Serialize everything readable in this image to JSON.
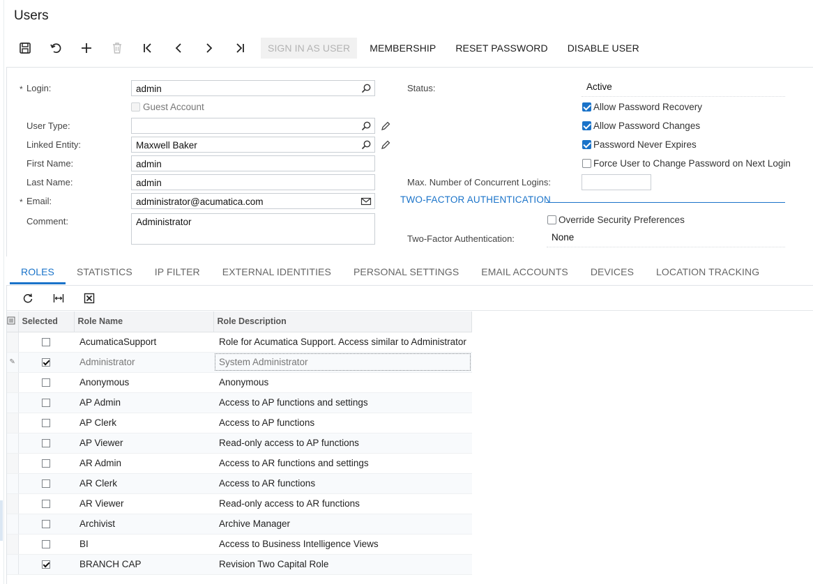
{
  "page": {
    "title": "Users"
  },
  "toolbar": {
    "icons": [
      "save-icon",
      "undo-icon",
      "add-icon",
      "delete-icon",
      "first-record-icon",
      "previous-record-icon",
      "next-record-icon",
      "last-record-icon"
    ],
    "sign_in_as_user": "SIGN IN AS USER",
    "membership": "MEMBERSHIP",
    "reset_password": "RESET PASSWORD",
    "disable_user": "DISABLE USER"
  },
  "form": {
    "login": {
      "label": "Login:",
      "value": "admin",
      "required": "*"
    },
    "guest_account": {
      "label": "Guest Account",
      "checked": false,
      "enabled": false
    },
    "user_type": {
      "label": "User Type:",
      "value": ""
    },
    "linked_entity": {
      "label": "Linked Entity:",
      "value": "Maxwell Baker"
    },
    "first_name": {
      "label": "First Name:",
      "value": "admin"
    },
    "last_name": {
      "label": "Last Name:",
      "value": "admin"
    },
    "email": {
      "label": "Email:",
      "value": "administrator@acumatica.com",
      "required": "*"
    },
    "comment": {
      "label": "Comment:",
      "value": "Administrator"
    },
    "status": {
      "label": "Status:",
      "value": "Active"
    },
    "allow_password_recovery": {
      "label": "Allow Password Recovery",
      "checked": true
    },
    "allow_password_changes": {
      "label": "Allow Password Changes",
      "checked": true
    },
    "password_never_expires": {
      "label": "Password Never Expires",
      "checked": true
    },
    "force_change_password": {
      "label": "Force User to Change Password on Next Login",
      "checked": false
    },
    "max_concurrent_logins": {
      "label": "Max. Number of Concurrent Logins:",
      "value": ""
    },
    "two_factor_section": "TWO-FACTOR AUTHENTICATION",
    "override_security": {
      "label": "Override Security Preferences",
      "checked": false
    },
    "two_factor_auth": {
      "label": "Two-Factor Authentication:",
      "value": "None"
    }
  },
  "tabs": [
    "ROLES",
    "STATISTICS",
    "IP FILTER",
    "EXTERNAL IDENTITIES",
    "PERSONAL SETTINGS",
    "EMAIL ACCOUNTS",
    "DEVICES",
    "LOCATION TRACKING"
  ],
  "active_tab": "ROLES",
  "grid": {
    "toolbar_icons": [
      "refresh-icon",
      "fit-columns-icon",
      "export-excel-icon"
    ],
    "columns": [
      "Selected",
      "Role Name",
      "Role Description"
    ],
    "rows": [
      {
        "selected": false,
        "role": "AcumaticaSupport",
        "description": "Role for Acumatica Support. Access similar to Administrator"
      },
      {
        "selected": true,
        "role": "Administrator",
        "description": "System Administrator",
        "editing": true
      },
      {
        "selected": false,
        "role": "Anonymous",
        "description": "Anonymous"
      },
      {
        "selected": false,
        "role": "AP Admin",
        "description": "Access to AP functions and settings"
      },
      {
        "selected": false,
        "role": "AP Clerk",
        "description": "Access to AP functions"
      },
      {
        "selected": false,
        "role": "AP Viewer",
        "description": "Read-only access to AP functions"
      },
      {
        "selected": false,
        "role": "AR Admin",
        "description": "Access to AR functions and settings"
      },
      {
        "selected": false,
        "role": "AR Clerk",
        "description": "Access to AR functions"
      },
      {
        "selected": false,
        "role": "AR Viewer",
        "description": "Read-only access to AR functions"
      },
      {
        "selected": false,
        "role": "Archivist",
        "description": "Archive Manager"
      },
      {
        "selected": false,
        "role": "BI",
        "description": "Access to Business Intelligence Views"
      },
      {
        "selected": true,
        "role": "BRANCH CAP",
        "description": "Revision Two Capital Role"
      }
    ]
  },
  "colors": {
    "accent": "#1a73c9",
    "text": "#222222",
    "muted": "#666666"
  }
}
